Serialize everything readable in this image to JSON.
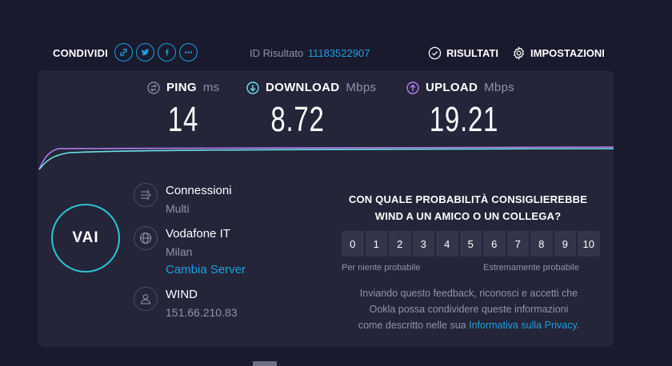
{
  "topbar": {
    "share_label": "CONDIVIDI",
    "share_icons": [
      "link-icon",
      "twitter-icon",
      "facebook-icon",
      "more-icon"
    ],
    "result_id_label": "ID Risultato",
    "result_id_value": "11183522907",
    "results_label": "RISULTATI",
    "settings_label": "IMPOSTAZIONI"
  },
  "metrics": {
    "ping": {
      "label": "PING",
      "unit": "ms",
      "value": "14"
    },
    "download": {
      "label": "DOWNLOAD",
      "unit": "Mbps",
      "value": "8.72"
    },
    "upload": {
      "label": "UPLOAD",
      "unit": "Mbps",
      "value": "19.21"
    }
  },
  "go_button": "VAI",
  "connections": {
    "title": "Connessioni",
    "value": "Multi"
  },
  "server": {
    "title": "Vodafone IT",
    "location": "Milan",
    "change_link": "Cambia Server"
  },
  "isp": {
    "title": "WIND",
    "ip": "151.66.210.83"
  },
  "survey": {
    "question_line1": "CON QUALE PROBABILITÀ CONSIGLIEREBBE",
    "question_line2": "WIND A UN AMICO O UN COLLEGA?",
    "scale": [
      "0",
      "1",
      "2",
      "3",
      "4",
      "5",
      "6",
      "7",
      "8",
      "9",
      "10"
    ],
    "low_label": "Per niente probabile",
    "high_label": "Estremamente probabile",
    "disclaimer_line1": "Inviando questo feedback, riconosci e accetti che",
    "disclaimer_line2": "Ookla possa condividere queste informazioni",
    "disclaimer_line3": "come descritto nelle sua",
    "privacy_link": "Informativa sulla Privacy",
    "disclaimer_end": "."
  },
  "colors": {
    "accent": "#1ba0e1",
    "download": "#6fe0e6",
    "upload": "#b57ef0",
    "background": "#1a1a2e",
    "panel": "#242539"
  }
}
